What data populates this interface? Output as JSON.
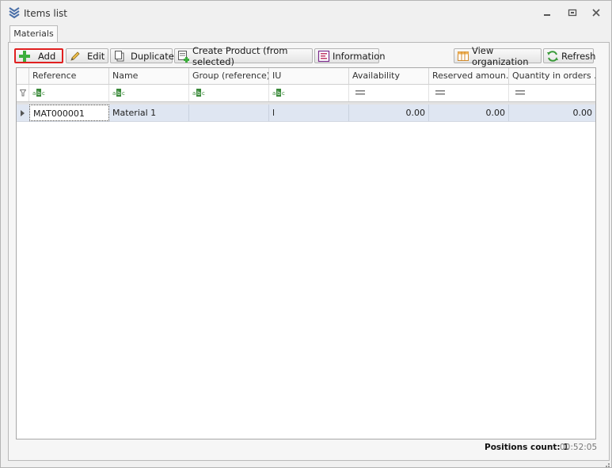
{
  "window": {
    "title": "Items list"
  },
  "tabs": [
    {
      "label": "Materials"
    }
  ],
  "toolbar": {
    "add_label": "Add",
    "edit_label": "Edit",
    "duplicate_label": "Duplicate",
    "create_product_label": "Create Product (from selected)",
    "information_label": "Information",
    "view_organization_label": "View organization",
    "refresh_label": "Refresh"
  },
  "grid": {
    "columns": [
      "Reference",
      "Name",
      "Group (reference)",
      "IU",
      "Availability",
      "Reserved amoun...",
      "Quantity in orders ..."
    ],
    "filters": [
      "abc",
      "abc",
      "abc",
      "abc",
      "=",
      "=",
      "="
    ],
    "rows": [
      {
        "reference": "MAT000001",
        "name": "Material 1",
        "group": "",
        "iu": "l",
        "availability": "0.00",
        "reserved": "0.00",
        "quantity_in_orders": "0.00"
      }
    ]
  },
  "status": {
    "positions_count": "Positions count: 1",
    "time": "00:52:05"
  },
  "colors": {
    "selected_row": "#dfe6f2",
    "add_highlight": "#e02020",
    "window_bg": "#f0f0f0"
  }
}
